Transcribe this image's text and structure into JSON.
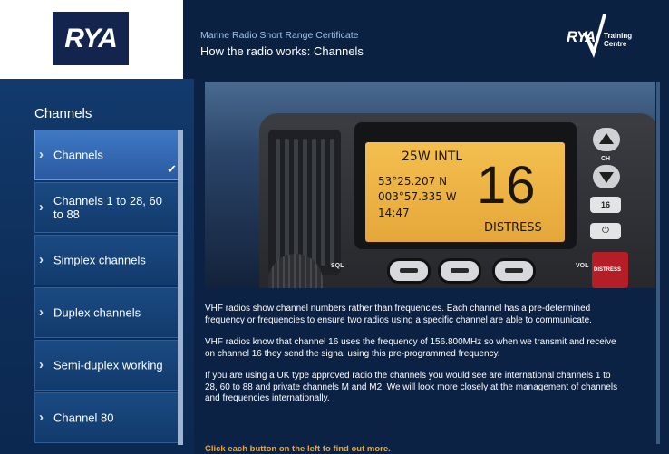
{
  "header": {
    "logo_text": "RYA",
    "course_title": "Marine Radio Short Range Certificate",
    "page_heading": "How the radio works: Channels",
    "training_logo": {
      "rya": "RYA",
      "line1": "Training",
      "line2": "Centre"
    }
  },
  "sidebar": {
    "title": "Channels",
    "items": [
      {
        "label": "Channels",
        "active": true
      },
      {
        "label": "Channels 1 to 28, 60 to 88"
      },
      {
        "label": "Simplex channels"
      },
      {
        "label": "Duplex channels"
      },
      {
        "label": "Semi-duplex working"
      },
      {
        "label": "Channel 80"
      }
    ]
  },
  "radio": {
    "power": "25W INTL",
    "lat": "53°25.207 N",
    "lon": "003°57.335 W",
    "time": "14:47",
    "channel": "16",
    "status": "DISTRESS",
    "ch_label": "CH",
    "btn_16": "16",
    "btn_power": "⏻",
    "sql_label": "SQL",
    "vol_label": "VOL",
    "distress_label": "DISTRESS"
  },
  "content": {
    "paragraphs": [
      "VHF radios show channel numbers rather than frequencies. Each channel has a pre-determined frequency or frequencies to ensure two radios using a specific channel are able to communicate.",
      "VHF radios know that channel 16 uses the frequency of 156.800MHz so when we transmit and receive on channel 16 they send the signal using this pre-programmed frequency.",
      "If you are using a UK type approved radio the channels you would see are international channels 1 to 28, 60 to 88 and private channels M and M2. We will look more closely at the management of channels and frequencies internationally."
    ],
    "instruction": "Click each button on the left to find out more."
  },
  "colors": {
    "accent": "#f0a820",
    "background": "#0b2244",
    "lcd": "#eeb447",
    "distress": "#b51e26"
  }
}
